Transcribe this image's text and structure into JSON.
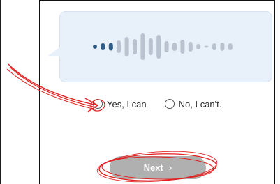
{
  "question": {
    "options": [
      {
        "label": "Yes, I can",
        "selected": false
      },
      {
        "label": "No, I can't.",
        "selected": false
      }
    ]
  },
  "audio": {
    "icon": "waveform-icon",
    "played_bars": 3,
    "total_bars": 18,
    "played_color": "#2e5b86",
    "unplayed_color": "#b9c3cf"
  },
  "footer": {
    "next_label": "Next",
    "next_icon": "chevron-right-icon"
  },
  "annotation_color": "#e02020"
}
